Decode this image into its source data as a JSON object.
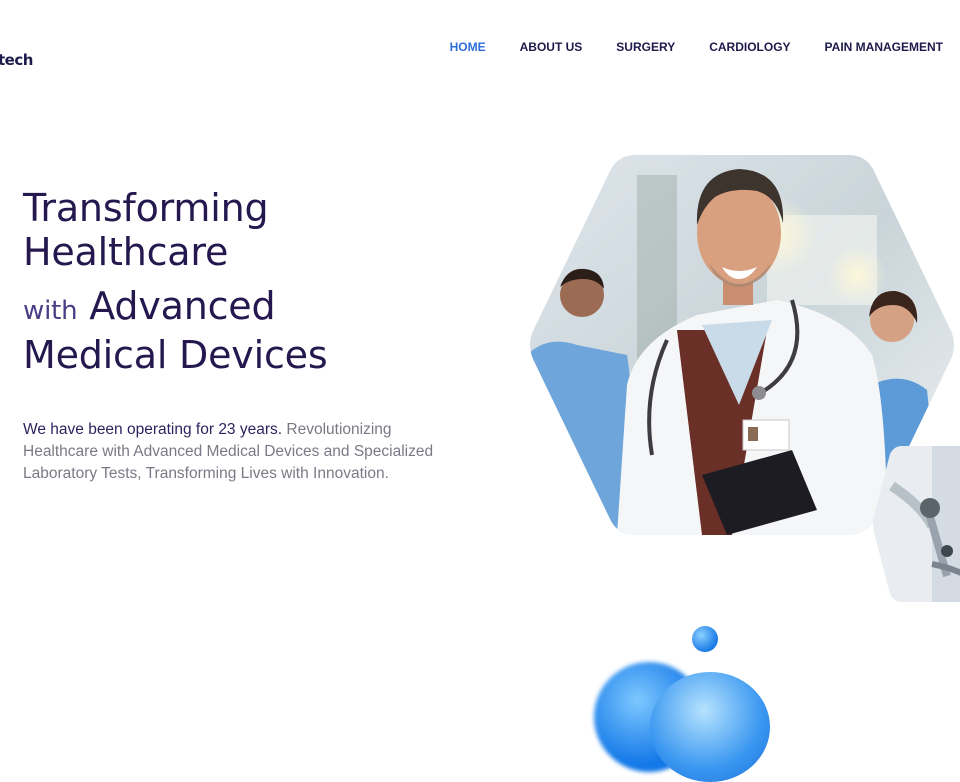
{
  "header": {
    "logo_text": "tech",
    "nav": [
      {
        "label": "HOME",
        "active": true
      },
      {
        "label": "ABOUT US",
        "active": false
      },
      {
        "label": "SURGERY",
        "active": false
      },
      {
        "label": "CARDIOLOGY",
        "active": false
      },
      {
        "label": "PAIN MANAGEMENT",
        "active": false
      }
    ]
  },
  "hero": {
    "title_line1": "Transforming",
    "title_line2": "Healthcare",
    "title_with": "with",
    "title_line3b": "Advanced",
    "title_line4": "Medical Devices",
    "desc_strong": "We have been operating for 23 years.",
    "desc_rest": " Revolutionizing Healthcare with Advanced Medical Devices and Specialized Laboratory Tests, Transforming Lives with Innovation."
  },
  "colors": {
    "accent": "#2f6fdc",
    "heading": "#24184f",
    "body_text": "#7a7a86",
    "blob_blue": "#1a7be6"
  }
}
